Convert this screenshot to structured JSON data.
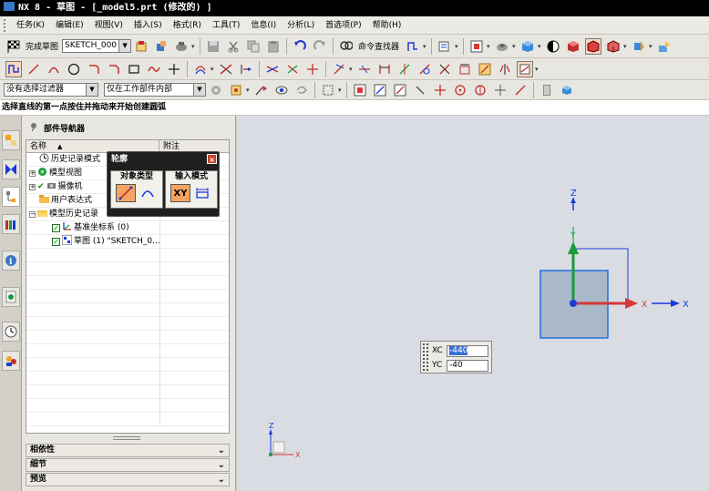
{
  "window": {
    "title": "NX 8 - 草图 - [_model5.prt  (修改的) ]"
  },
  "menu": [
    "任务(K)",
    "编辑(E)",
    "视图(V)",
    "插入(S)",
    "格式(R)",
    "工具(T)",
    "信息(I)",
    "分析(L)",
    "首选项(P)",
    "帮助(H)"
  ],
  "toolbar1": {
    "finish_sketch_label": "完成草图",
    "sketch_name": "SKETCH_000",
    "command_finder_label": "命令查找器"
  },
  "selection_bar": {
    "filter_value": "没有选择过滤器",
    "scope_value": "仅在工作部件内部"
  },
  "cue_line": "选择直线的第一点按住并拖动来开始创建圆弧",
  "part_navigator": {
    "title": "部件导航器",
    "col_name": "名称",
    "col_note": "附注",
    "rows": [
      {
        "label": "历史记录模式",
        "icon": "clock-icon"
      },
      {
        "label": "模型视图",
        "icon": "model-views-icon"
      },
      {
        "label": "摄像机",
        "icon": "camera-icon"
      },
      {
        "label": "用户表达式",
        "icon": "folder-icon"
      },
      {
        "label": "模型历史记录",
        "icon": "folder-open-icon"
      },
      {
        "label": "基准坐标系 (0)",
        "icon": "datum-csys-icon"
      },
      {
        "label": "草图 (1) \"SKETCH_0...",
        "icon": "sketch-icon"
      }
    ],
    "sections": [
      "相依性",
      "细节",
      "预览"
    ]
  },
  "profile_dialog": {
    "title": "轮廓",
    "object_type_label": "对象类型",
    "input_mode_label": "输入模式",
    "xy_label": "XY"
  },
  "coord_input": {
    "xc_label": "XC",
    "xc_value": "-440",
    "yc_label": "YC",
    "yc_value": "-40"
  },
  "viewport_axes": {
    "x_label": "X",
    "y_label": "Y",
    "z_label": "Z"
  },
  "colors": {
    "accent_blue": "#3a6ed8",
    "viewport_bg": "#d9dde3",
    "sketch_rect_fill": "#a9b9c9",
    "sketch_rect_stroke": "#1e6fe0",
    "axis_x": "#d63838",
    "axis_y": "#1a9a3a",
    "axis_z": "#1a3ad8"
  }
}
